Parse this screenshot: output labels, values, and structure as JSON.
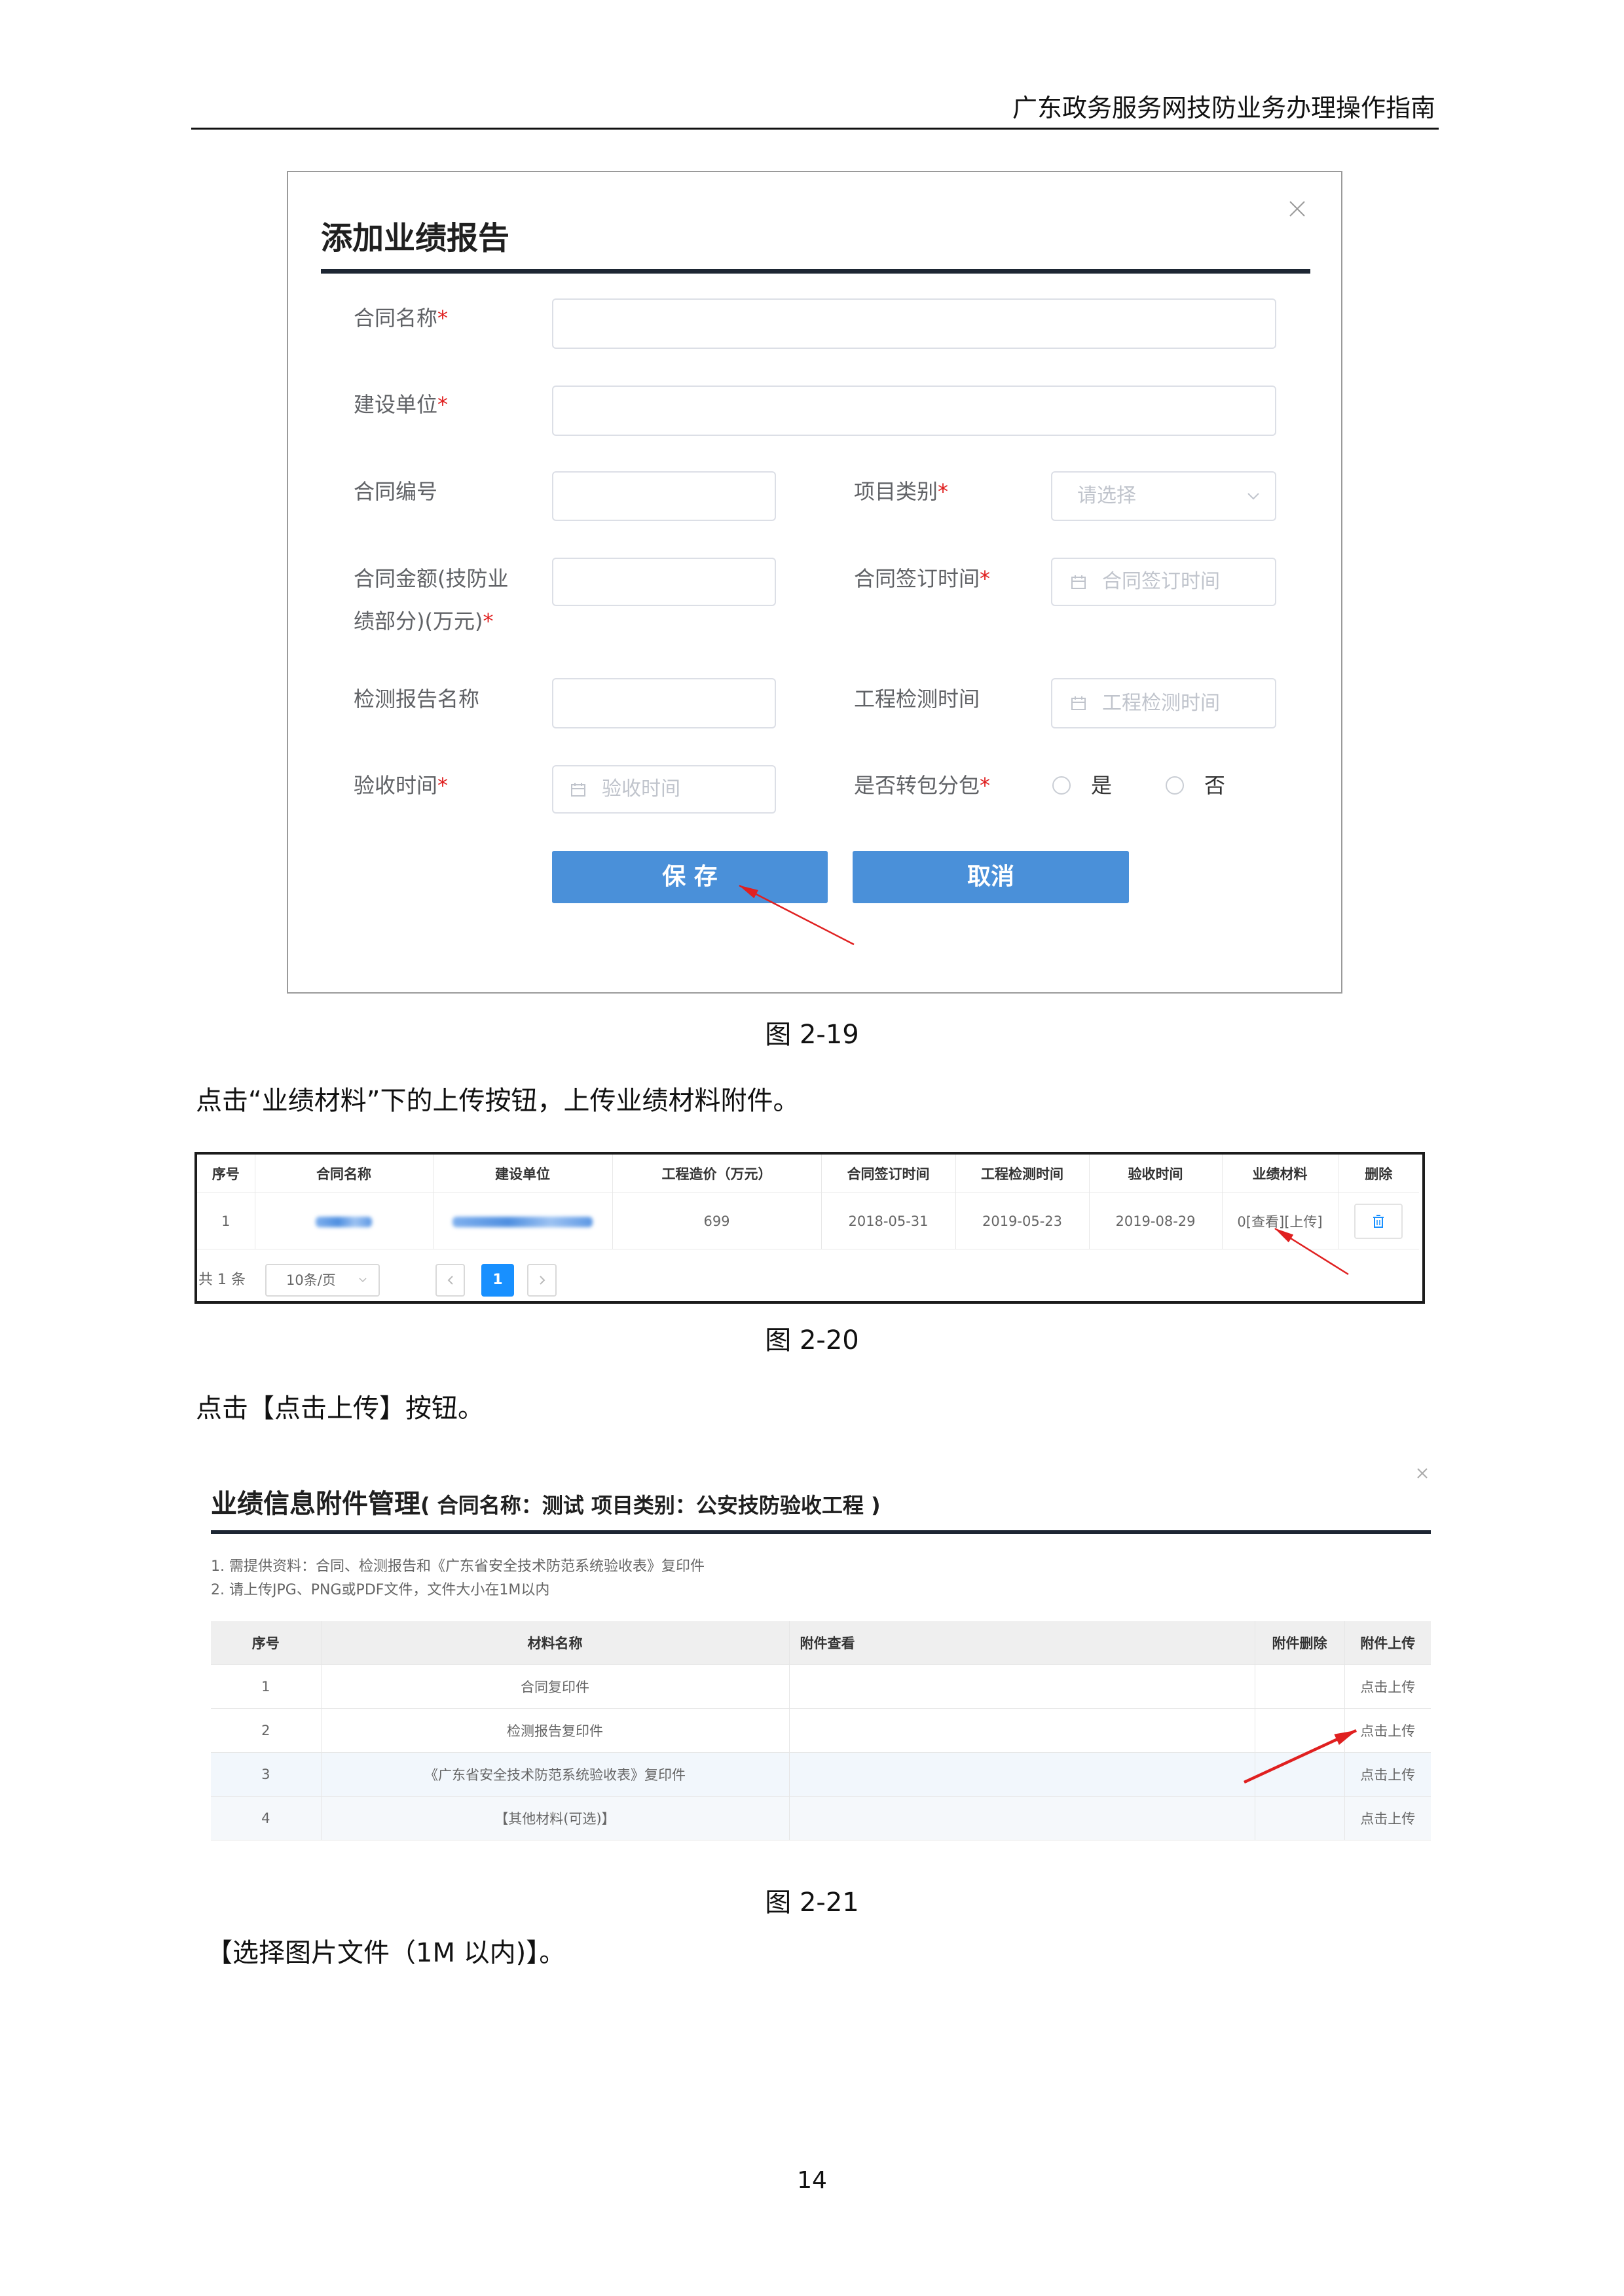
{
  "colors": {
    "accent": "#4a90d9",
    "required": "#e02020",
    "annotation": "#e02020",
    "link": "#3b7fd6",
    "page_active": "#1890ff"
  },
  "icons": {
    "close": "close-icon",
    "select": "chevron-down-icon",
    "date": "calendar-icon",
    "delete": "trash-icon",
    "prev": "chevron-left-icon",
    "next": "chevron-right-icon"
  },
  "header": {
    "title": "广东政务服务网技防业务办理操作指南"
  },
  "fig19": {
    "title": "添加业绩报告",
    "required_mark": "*",
    "form": {
      "contract_name": {
        "label": "合同名称"
      },
      "construction_unit": {
        "label": "建设单位"
      },
      "contract_no": {
        "label": "合同编号"
      },
      "project_category": {
        "label": "项目类别",
        "placeholder": "请选择"
      },
      "contract_amount": {
        "label_line1": "合同金额(技防业",
        "label_line2": "绩部分)(万元)"
      },
      "sign_time": {
        "label": "合同签订时间",
        "placeholder": "合同签订时间"
      },
      "report_name": {
        "label": "检测报告名称"
      },
      "inspection_time": {
        "label": "工程检测时间",
        "placeholder": "工程检测时间"
      },
      "acceptance_time": {
        "label": "验收时间",
        "placeholder": "验收时间"
      },
      "subcontract": {
        "label": "是否转包分包",
        "options": [
          "是",
          "否"
        ]
      }
    },
    "buttons": {
      "save": "保 存",
      "cancel": "取消"
    },
    "caption": "图 2-19"
  },
  "paragraphs": [
    "点击“业绩材料”下的上传按钮，上传业绩材料附件。",
    "点击【点击上传】按钮。",
    "【选择图片文件（1M 以内)】。"
  ],
  "fig20": {
    "headers": [
      "序号",
      "合同名称",
      "建设单位",
      "工程造价（万元）",
      "合同签订时间",
      "工程检测时间",
      "验收时间",
      "业绩材料",
      "删除"
    ],
    "rows": [
      {
        "index": "1",
        "cost": "699",
        "sign_date": "2018-05-31",
        "inspection_date": "2019-05-23",
        "acceptance_date": "2019-08-29",
        "materials_count": "0",
        "view_link": "[查看]",
        "upload_link": "[上传]"
      }
    ],
    "footer": {
      "total": "共 1 条",
      "page_size": "10条/页",
      "current_page": "1"
    },
    "caption": "图 2-20"
  },
  "fig21": {
    "title": "业绩信息附件管理",
    "subtitle": "( 合同名称：测试  项目类别：公安技防验收工程 )",
    "notes": [
      "1. 需提供资料：合同、检测报告和《广东省安全技术防范系统验收表》复印件",
      "2. 请上传JPG、PNG或PDF文件，文件大小在1M以内"
    ],
    "headers": [
      "序号",
      "材料名称",
      "附件查看",
      "附件删除",
      "附件上传"
    ],
    "rows": [
      {
        "index": "1",
        "name": "合同复印件",
        "upload": "点击上传"
      },
      {
        "index": "2",
        "name": "检测报告复印件",
        "upload": "点击上传"
      },
      {
        "index": "3",
        "name": "《广东省安全技术防范系统验收表》复印件",
        "upload": "点击上传"
      },
      {
        "index": "4",
        "name": "【其他材料(可选)】",
        "upload": "点击上传"
      }
    ],
    "caption": "图 2-21"
  },
  "page_number": "14"
}
